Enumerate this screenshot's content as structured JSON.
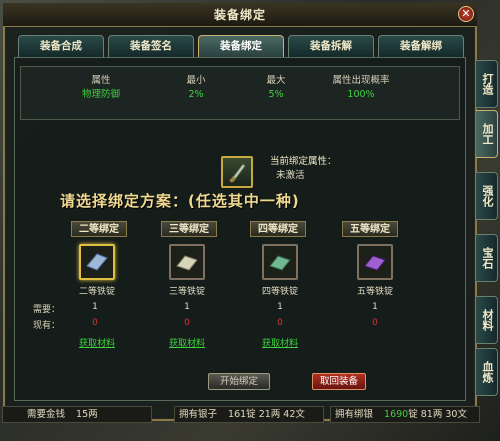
{
  "window": {
    "title": "装备绑定",
    "close": "✕"
  },
  "tabs": [
    {
      "label": "装备合成"
    },
    {
      "label": "装备签名"
    },
    {
      "label": "装备绑定"
    },
    {
      "label": "装备拆解"
    },
    {
      "label": "装备解绑"
    }
  ],
  "side_tabs": [
    {
      "label": "打造"
    },
    {
      "label": "加工"
    },
    {
      "label": "强化"
    },
    {
      "label": "宝石"
    },
    {
      "label": "材料"
    },
    {
      "label": "血炼"
    }
  ],
  "stats": {
    "headers": [
      "属性",
      "最小",
      "最大",
      "属性出现概率"
    ],
    "values": [
      "物理防御",
      "2%",
      "5%",
      "100%"
    ]
  },
  "current": {
    "label": "当前绑定属性：",
    "state": "未激活"
  },
  "choose_text": "请选择绑定方案：(任选其中一种)",
  "plans": [
    {
      "title": "二等绑定",
      "item": "二等铁锭",
      "need": "1",
      "have": "0",
      "obtain": "获取材料"
    },
    {
      "title": "三等绑定",
      "item": "三等铁锭",
      "need": "1",
      "have": "0",
      "obtain": "获取材料"
    },
    {
      "title": "四等绑定",
      "item": "四等铁锭",
      "need": "1",
      "have": "0",
      "obtain": "获取材料"
    },
    {
      "title": "五等绑定",
      "item": "五等铁锭",
      "need": "1",
      "have": "0",
      "obtain": "获取材料"
    }
  ],
  "row_labels": {
    "need": "需要：",
    "have": "现有："
  },
  "buttons": {
    "start": "开始绑定",
    "retrieve": "取回装备"
  },
  "footer": {
    "gold_label": "需要金钱",
    "gold_value": "15两",
    "silver_label": "拥有银子",
    "silver_value": "161锭 21两 42文",
    "bound_label": "拥有绑银",
    "bound_green": "1690",
    "bound_rest": "锭 81两 30文"
  }
}
